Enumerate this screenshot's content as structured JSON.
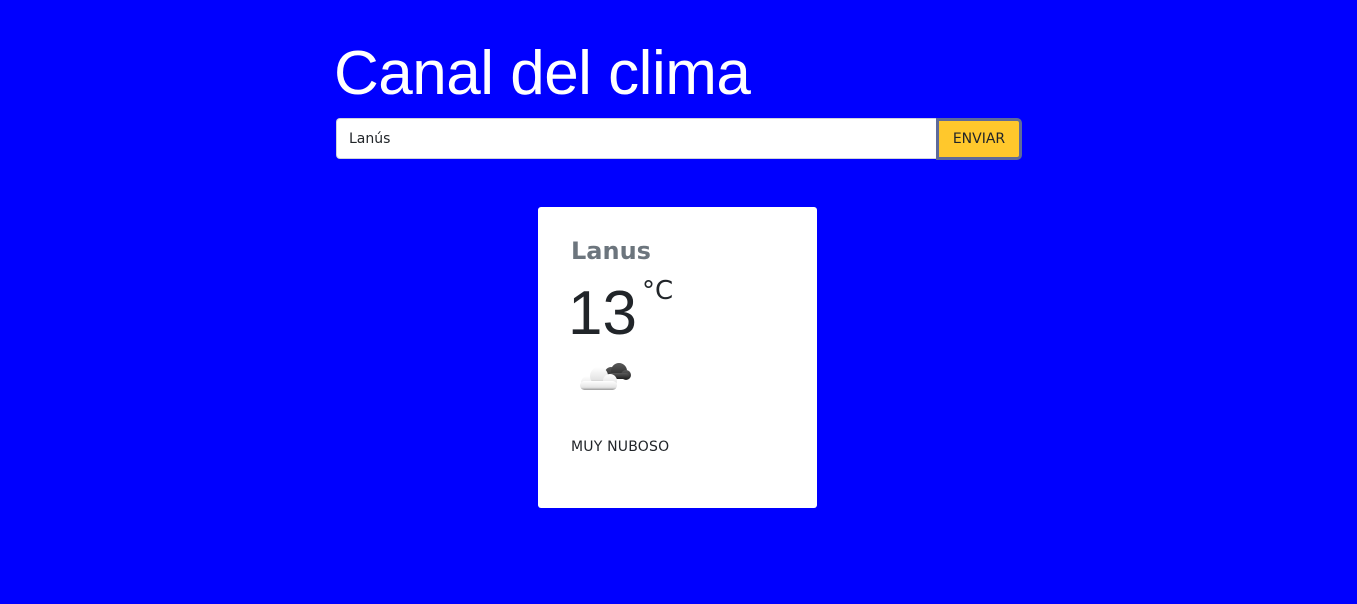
{
  "header": {
    "title": "Canal del clima"
  },
  "search": {
    "value": "Lanús",
    "button_label": "ENVIAR"
  },
  "weather_card": {
    "city": "Lanus",
    "temperature": "13",
    "unit": "°C",
    "icon": "cloud-icon",
    "description": "MUY NUBOSO"
  },
  "colors": {
    "background": "#0000ff",
    "button": "#ffc82c",
    "card": "#ffffff"
  }
}
